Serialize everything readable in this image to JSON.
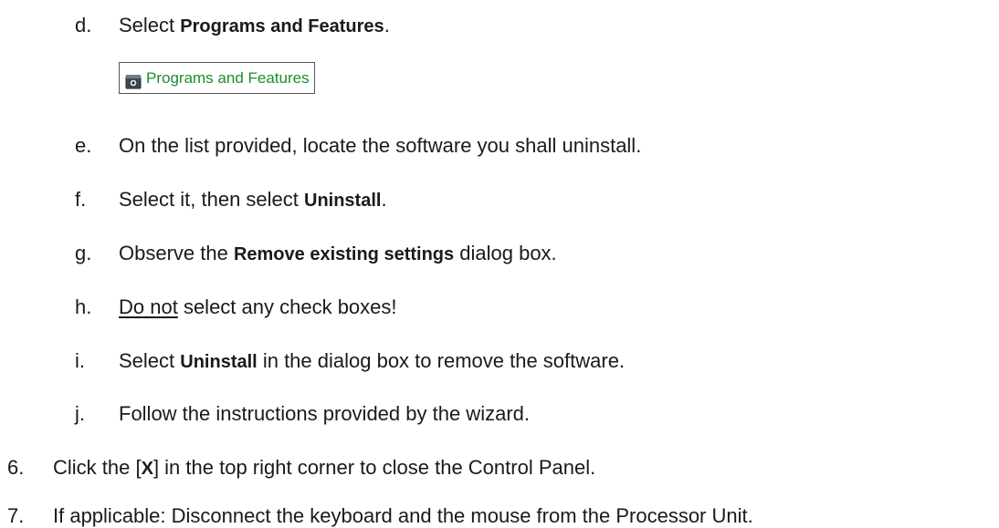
{
  "steps": [
    {
      "marker": "d.",
      "parts": [
        {
          "t": "Select ",
          "s": ""
        },
        {
          "t": "Programs and Features",
          "s": "bold"
        },
        {
          "t": ".",
          "s": ""
        }
      ]
    },
    {
      "marker": "e.",
      "parts": [
        {
          "t": "On the list provided, locate the software you shall uninstall.",
          "s": ""
        }
      ]
    },
    {
      "marker": "f.",
      "parts": [
        {
          "t": "Select it, then select ",
          "s": ""
        },
        {
          "t": "Uninstall",
          "s": "bold"
        },
        {
          "t": ".",
          "s": ""
        }
      ]
    },
    {
      "marker": "g.",
      "parts": [
        {
          "t": "Observe the ",
          "s": ""
        },
        {
          "t": "Remove existing settings",
          "s": "bold"
        },
        {
          "t": " dialog box.",
          "s": ""
        }
      ]
    },
    {
      "marker": "h.",
      "parts": [
        {
          "t": "Do not",
          "s": "u"
        },
        {
          "t": " select any check boxes!",
          "s": ""
        }
      ]
    },
    {
      "marker": "i.",
      "parts": [
        {
          "t": "Select ",
          "s": ""
        },
        {
          "t": "Uninstall",
          "s": "bold"
        },
        {
          "t": " in the dialog box to remove the software.",
          "s": ""
        }
      ]
    },
    {
      "marker": "j.",
      "parts": [
        {
          "t": "Follow the instructions provided by the wizard.",
          "s": ""
        }
      ]
    },
    {
      "marker": "6.",
      "parts": [
        {
          "t": "Click the [",
          "s": ""
        },
        {
          "t": "X",
          "s": "bold"
        },
        {
          "t": "] in the top right corner to close the Control Panel.",
          "s": ""
        }
      ]
    },
    {
      "marker": "7.",
      "parts": [
        {
          "t": "If applicable: Disconnect the keyboard and the mouse from the Processor Unit.",
          "s": ""
        }
      ]
    }
  ],
  "programs_features": {
    "label": "Programs and Features",
    "label_color": "#1e8c2e",
    "icon": "control-panel-programs-icon"
  }
}
